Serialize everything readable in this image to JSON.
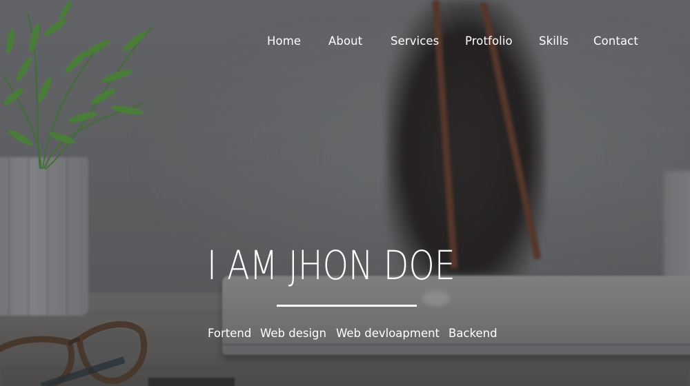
{
  "nav": {
    "items": [
      "Home",
      "About",
      "Services",
      "Protfolio",
      "Skills",
      "Contact"
    ]
  },
  "hero": {
    "title": "I AM JHON DOE",
    "skills": [
      "Fortend",
      "Web design",
      "Web devloapment",
      "Backend"
    ]
  },
  "colors": {
    "text": "#ffffff",
    "overlay": "#5f6163"
  },
  "icons": {
    "background": "desk-photo-background"
  }
}
